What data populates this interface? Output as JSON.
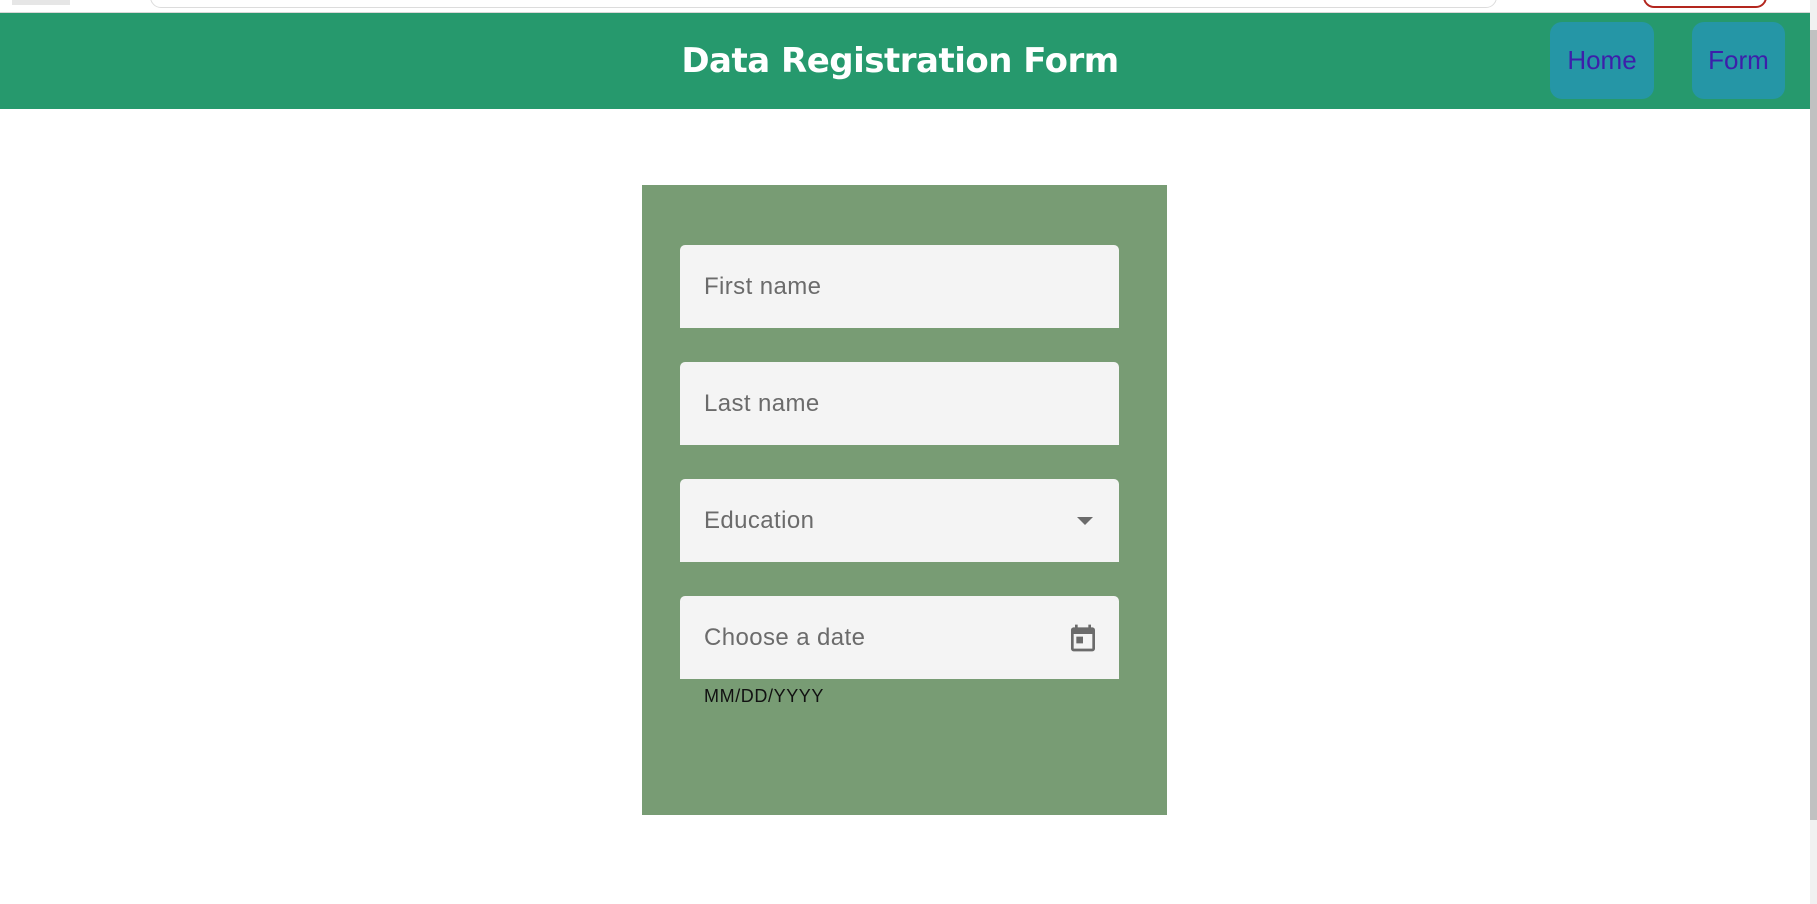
{
  "header": {
    "title": "Data Registration Form",
    "nav": [
      {
        "label": "Home"
      },
      {
        "label": "Form"
      }
    ]
  },
  "form": {
    "first_name": {
      "placeholder": "First name",
      "value": ""
    },
    "last_name": {
      "placeholder": "Last name",
      "value": ""
    },
    "education": {
      "label": "Education",
      "icon": "arrow-drop-down-icon"
    },
    "date": {
      "placeholder": "Choose a date",
      "hint": "MM/DD/YYYY",
      "icon": "calendar-icon"
    }
  },
  "colors": {
    "toolbar": "#26996d",
    "nav_button_bg": "#2596a6",
    "nav_button_text": "#3d1faa",
    "card": "#789c74",
    "field": "#f4f4f4"
  }
}
